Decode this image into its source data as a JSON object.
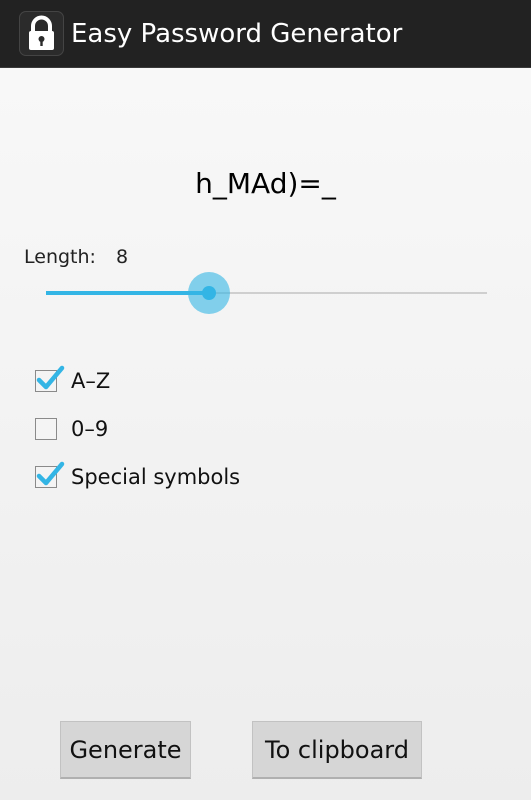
{
  "app": {
    "title": "Easy Password Generator",
    "icon": "lock-icon"
  },
  "password": "h_MAd)=_",
  "length": {
    "label": "Length:",
    "value": "8",
    "level_fraction": 0.37,
    "accent_color": "#33b5e5"
  },
  "options": [
    {
      "label": "A–Z",
      "checked": true
    },
    {
      "label": "0–9",
      "checked": false
    },
    {
      "label": "Special symbols",
      "checked": true
    }
  ],
  "buttons": {
    "generate": "Generate",
    "clipboard": "To clipboard"
  }
}
